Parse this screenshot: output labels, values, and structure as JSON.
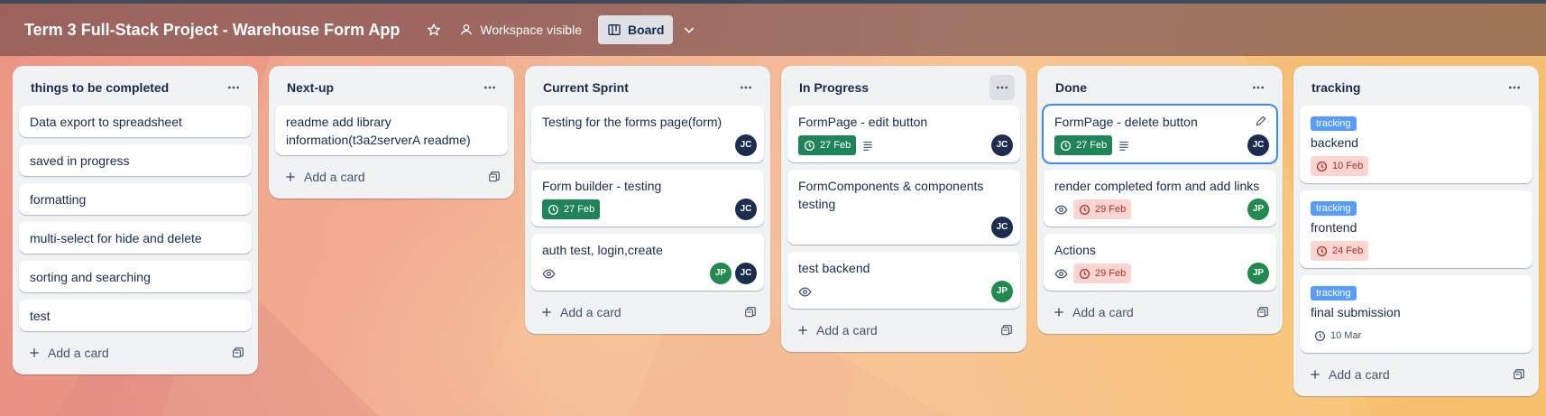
{
  "header": {
    "board_title": "Term 3 Full-Stack Project - Warehouse Form App",
    "visibility_label": "Workspace visible",
    "view_label": "Board"
  },
  "icons": {
    "star": "star-icon",
    "visibility": "workspace-icon",
    "board": "board-view-icon",
    "chevron": "chevron-down-icon",
    "list_menu": "more-icon",
    "add": "plus-icon",
    "template": "card-template-icon",
    "clock": "clock-icon",
    "description": "description-icon",
    "watch": "eye-icon",
    "edit": "pencil-icon"
  },
  "colors": {
    "label_blue": "#579dff",
    "due_complete": "#1f845a",
    "due_overdue_bg": "#ffd5d2",
    "due_overdue_text": "#ae2e24",
    "avatar_jc": "#1d2d4f",
    "avatar_jp": "#238a4f",
    "focus_ring": "#388bff"
  },
  "add_card_label": "Add a card",
  "lists": [
    {
      "title": "things to be completed",
      "cards": [
        {
          "title": "Data export to spreadsheet"
        },
        {
          "title": "saved in progress"
        },
        {
          "title": "formatting"
        },
        {
          "title": "multi-select for hide and delete"
        },
        {
          "title": "sorting and searching"
        },
        {
          "title": "test"
        }
      ]
    },
    {
      "title": "Next-up",
      "cards": [
        {
          "title": "readme add library information(t3a2serverA readme)"
        }
      ]
    },
    {
      "title": "Current Sprint",
      "cards": [
        {
          "title": "Testing for the forms page(form)",
          "members": [
            "JC"
          ]
        },
        {
          "title": "Form builder - testing",
          "due": "27 Feb",
          "members": [
            "JC"
          ]
        },
        {
          "title": "auth test, login,create",
          "members": [
            "JP",
            "JC"
          ]
        }
      ]
    },
    {
      "title": "In Progress",
      "cards": [
        {
          "title": "FormPage - edit button",
          "due": "27 Feb",
          "members": [
            "JC"
          ]
        },
        {
          "title": "FormComponents & components testing",
          "members": [
            "JC"
          ]
        },
        {
          "title": "test backend",
          "members": [
            "JP"
          ]
        }
      ]
    },
    {
      "title": "Done",
      "cards": [
        {
          "title": "FormPage - delete button",
          "due": "27 Feb",
          "members": [
            "JC"
          ]
        },
        {
          "title": "render completed form and add links",
          "due": "29 Feb",
          "members": [
            "JP"
          ]
        },
        {
          "title": "Actions",
          "due": "29 Feb",
          "members": [
            "JP"
          ]
        }
      ]
    },
    {
      "title": "tracking",
      "cards": [
        {
          "label": "tracking",
          "title": "backend",
          "due": "10 Feb"
        },
        {
          "label": "tracking",
          "title": "frontend",
          "due": "24 Feb"
        },
        {
          "label": "tracking",
          "title": "final submission",
          "due": "10 Mar"
        }
      ]
    }
  ]
}
